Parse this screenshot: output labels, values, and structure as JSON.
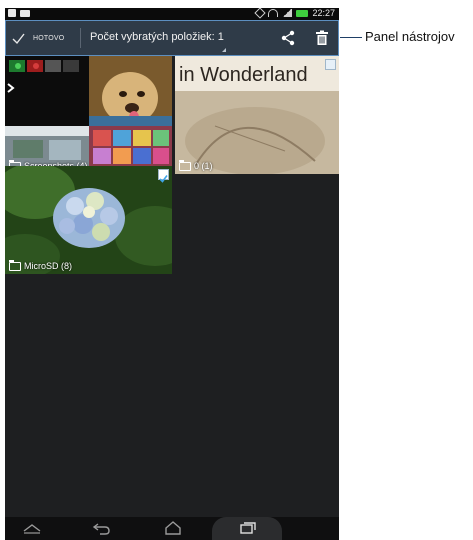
{
  "toolbar": {
    "done_label": "HOTOVO",
    "selected_count_label": "Počet vybratých položiek: 1",
    "share_icon": "share-icon",
    "delete_icon": "trash-icon"
  },
  "status_bar": {
    "time": "22:27"
  },
  "callout": {
    "label": "Panel nástrojov"
  },
  "albums": [
    {
      "caption": "Screenshots (4)",
      "checked": false,
      "thumbnail_text": ""
    },
    {
      "caption": "0 (1)",
      "checked": false,
      "thumbnail_text": "in Wonderland"
    },
    {
      "caption": "MicroSD (8)",
      "checked": true,
      "thumbnail_text": ""
    }
  ],
  "colors": {
    "toolbar_bg": "#2f3b48",
    "toolbar_border": "#5d8fc0",
    "grid_bg": "#1e1f21",
    "check_accent": "#3fa6e8"
  }
}
